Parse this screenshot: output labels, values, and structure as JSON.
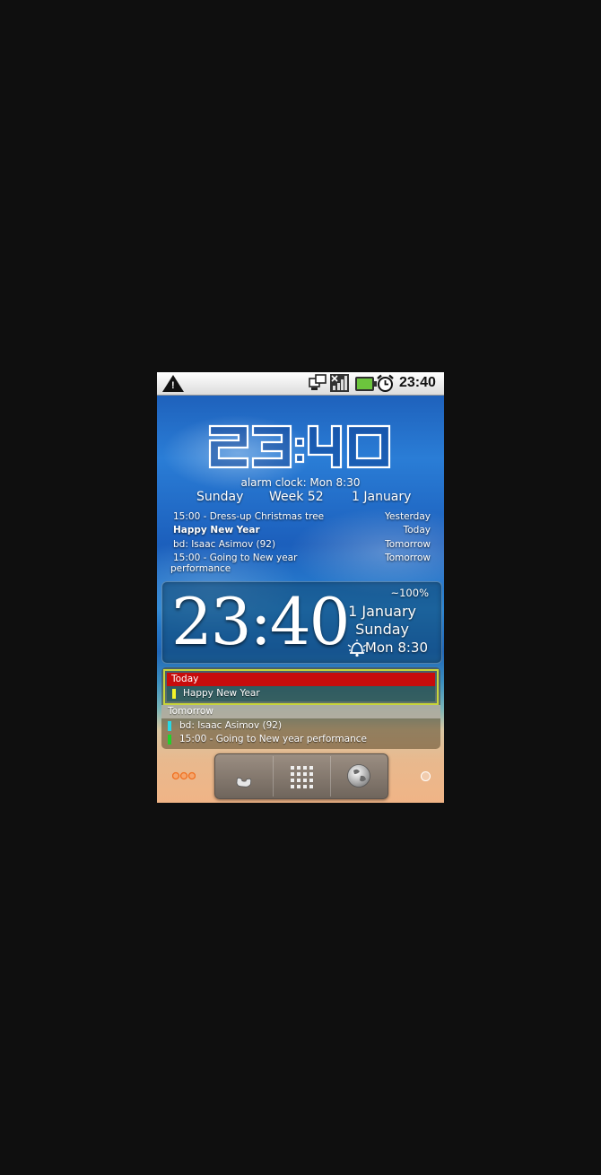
{
  "status_bar": {
    "time": "23:40",
    "icons": [
      "warning-icon",
      "sync-icon",
      "signal-icon",
      "battery-icon",
      "alarm-icon"
    ],
    "battery_color": "#6cc53d"
  },
  "clock_widget": {
    "time": "23:40",
    "alarm": "alarm clock: Mon 8:30",
    "day": "Sunday",
    "week": "Week 52",
    "date": "1 January",
    "events": [
      {
        "title": "15:00 - Dress-up Christmas tree",
        "when": "Yesterday",
        "bold": false
      },
      {
        "title": "Happy New Year",
        "when": "Today",
        "bold": true
      },
      {
        "title": "bd: Isaac Asimov (92)",
        "when": "Tomorrow",
        "bold": false
      },
      {
        "title_line1": "15:00 - Going to New year",
        "title_line2": "performance",
        "when": "Tomorrow",
        "bold": false
      }
    ]
  },
  "clock_widget2": {
    "time": "23:40",
    "battery": "~100%",
    "date": "1 January",
    "day": "Sunday",
    "alarm": "Mon 8:30"
  },
  "calendar_widget": {
    "today_label": "Today",
    "today_items": [
      {
        "title": "Happy New Year",
        "color": "#f3f32a"
      }
    ],
    "tomorrow_label": "Tomorrow",
    "tomorrow_items": [
      {
        "title": "bd: Isaac Asimov (92)",
        "color": "#27d9e8"
      },
      {
        "title": "15:00 - Going to New year performance",
        "color": "#22d12a"
      }
    ],
    "header_color": "#c70c0c",
    "border_color": "#c8d43a"
  },
  "dock": {
    "icons": [
      "phone-icon",
      "app-grid-icon",
      "browser-globe-icon"
    ]
  }
}
